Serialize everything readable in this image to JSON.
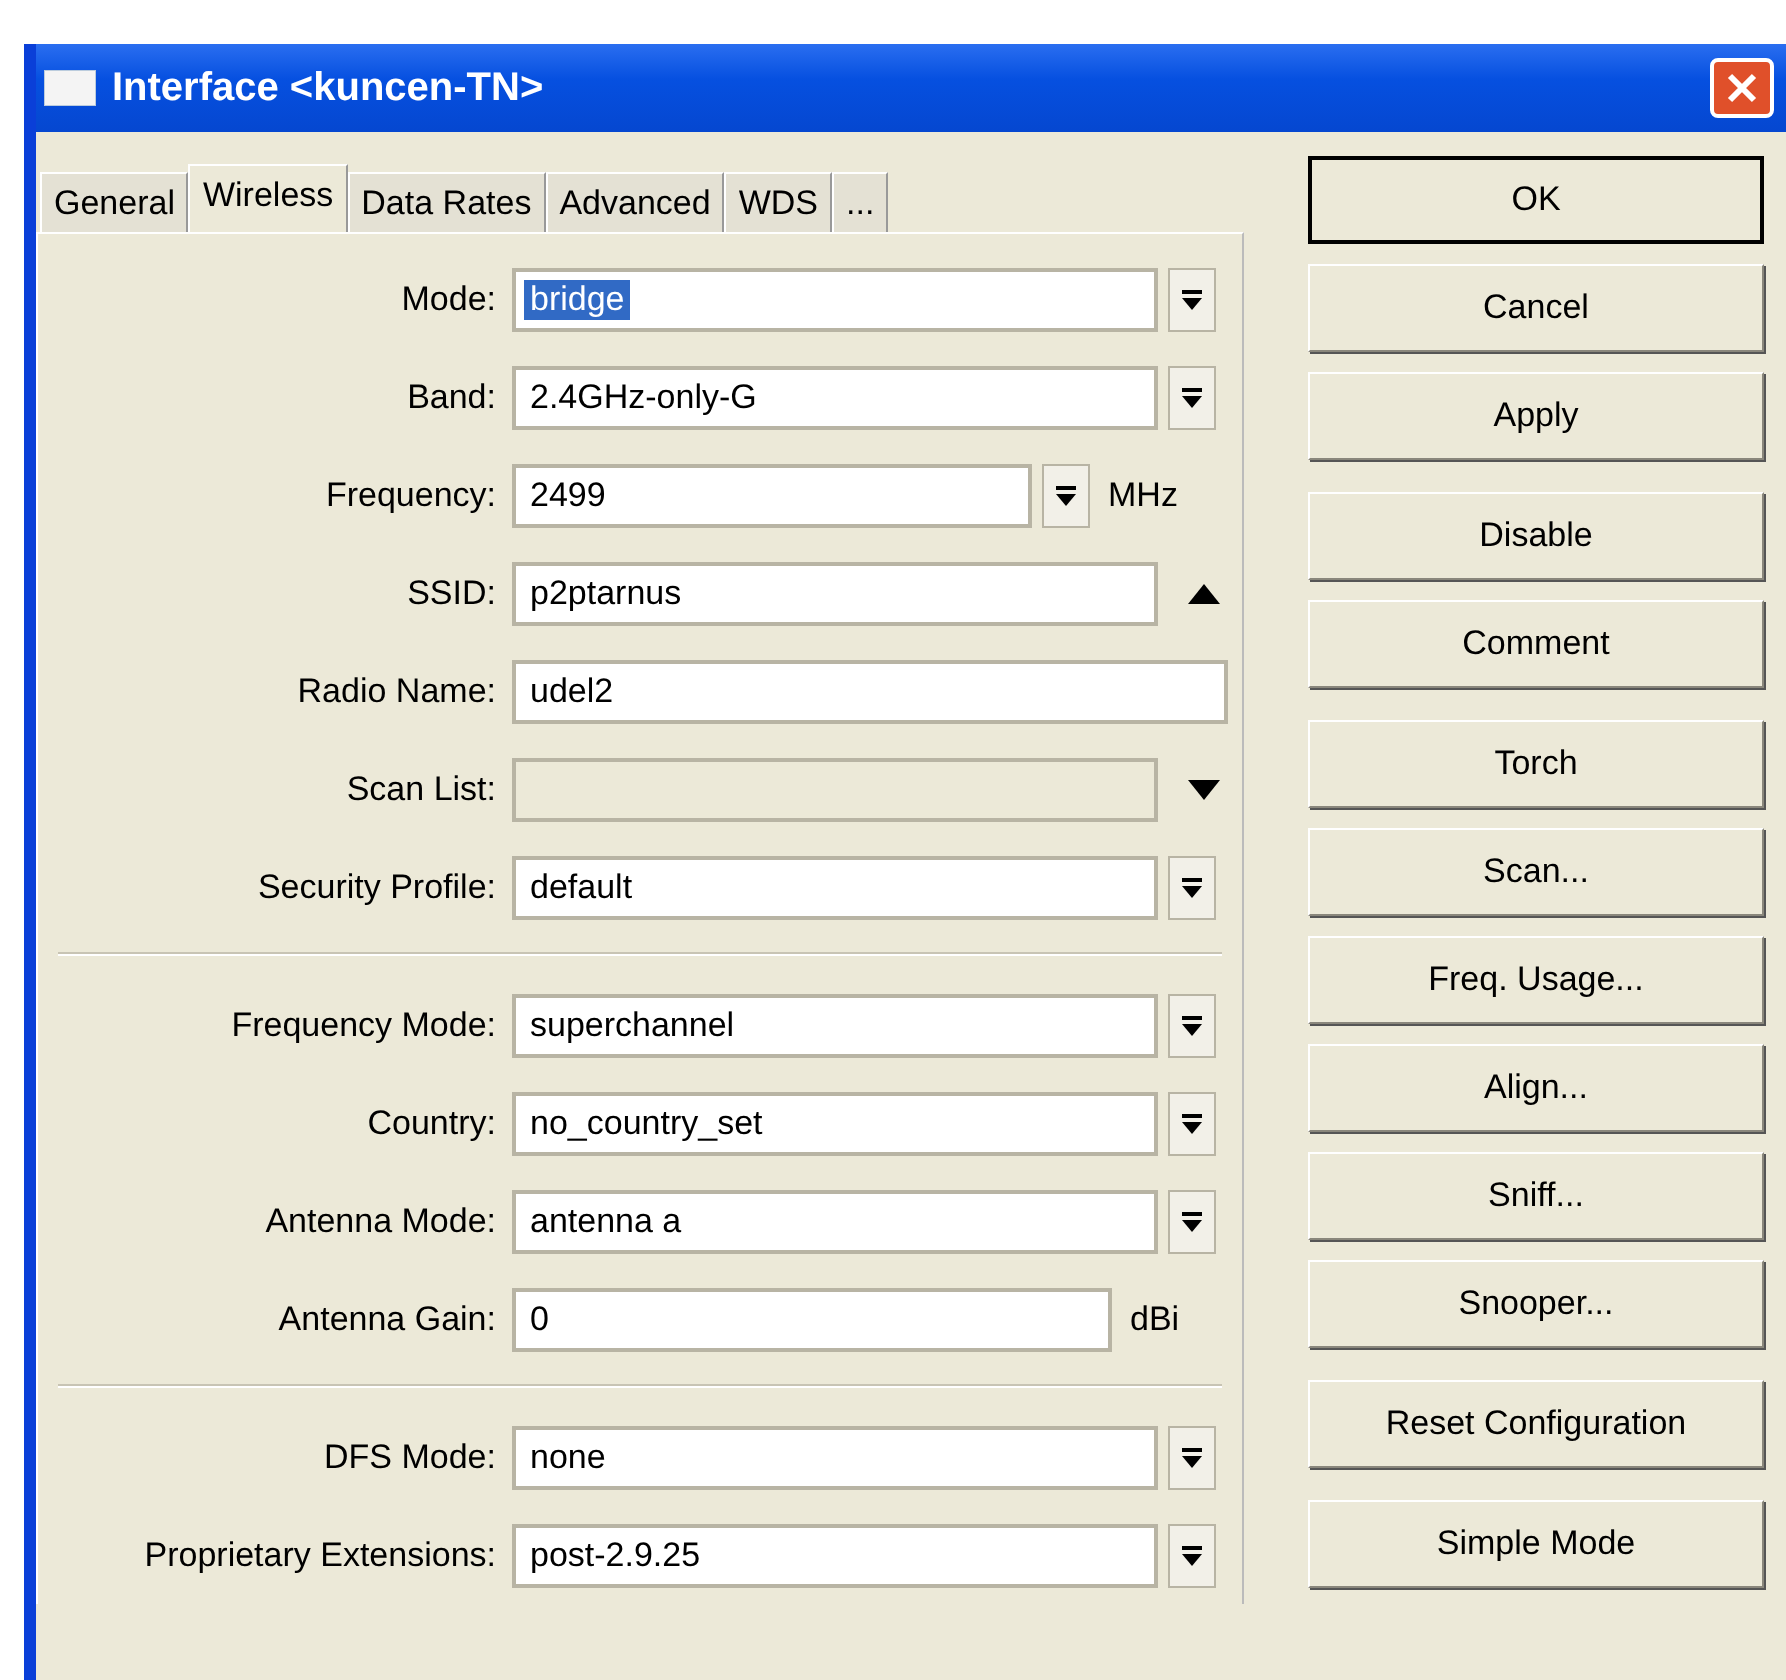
{
  "window": {
    "title": "Interface <kuncen-TN>"
  },
  "tabs": [
    {
      "label": "General",
      "selected": false
    },
    {
      "label": "Wireless",
      "selected": true
    },
    {
      "label": "Data Rates",
      "selected": false
    },
    {
      "label": "Advanced",
      "selected": false
    },
    {
      "label": "WDS",
      "selected": false
    },
    {
      "label": "...",
      "selected": false
    }
  ],
  "sections": [
    {
      "fields": [
        {
          "label": "Mode:",
          "value": "bridge",
          "kind": "dropdown",
          "selected": true
        },
        {
          "label": "Band:",
          "value": "2.4GHz-only-G",
          "kind": "dropdown",
          "selected": false
        },
        {
          "label": "Frequency:",
          "value": "2499",
          "kind": "dropdown_unit",
          "unit": "MHz",
          "selected": false
        },
        {
          "label": "SSID:",
          "value": "p2ptarnus",
          "kind": "collapsible",
          "selected": false
        },
        {
          "label": "Radio Name:",
          "value": "udel2",
          "kind": "text",
          "selected": false
        },
        {
          "label": "Scan List:",
          "kind": "disabled_list"
        },
        {
          "label": "Security Profile:",
          "value": "default",
          "kind": "dropdown",
          "selected": false
        }
      ]
    },
    {
      "fields": [
        {
          "label": "Frequency Mode:",
          "value": "superchannel",
          "kind": "dropdown",
          "selected": false
        },
        {
          "label": "Country:",
          "value": "no_country_set",
          "kind": "dropdown",
          "selected": false
        },
        {
          "label": "Antenna Mode:",
          "value": "antenna a",
          "kind": "dropdown",
          "selected": false
        },
        {
          "label": "Antenna Gain:",
          "value": "0",
          "kind": "text_unit",
          "unit": "dBi",
          "selected": false
        }
      ]
    },
    {
      "fields": [
        {
          "label": "DFS Mode:",
          "value": "none",
          "kind": "dropdown",
          "selected": false
        },
        {
          "label": "Proprietary Extensions:",
          "value": "post-2.9.25",
          "kind": "dropdown",
          "selected": false
        }
      ]
    }
  ],
  "button_groups": [
    {
      "buttons": [
        {
          "label": "OK",
          "default": true
        },
        {
          "label": "Cancel",
          "default": false
        },
        {
          "label": "Apply",
          "default": false
        }
      ]
    },
    {
      "buttons": [
        {
          "label": "Disable",
          "default": false
        },
        {
          "label": "Comment",
          "default": false
        }
      ]
    },
    {
      "buttons": [
        {
          "label": "Torch",
          "default": false
        },
        {
          "label": "Scan...",
          "default": false
        },
        {
          "label": "Freq. Usage...",
          "default": false
        },
        {
          "label": "Align...",
          "default": false
        },
        {
          "label": "Sniff...",
          "default": false
        },
        {
          "label": "Snooper...",
          "default": false
        }
      ]
    },
    {
      "buttons": [
        {
          "label": "Reset Configuration",
          "default": false
        }
      ]
    },
    {
      "buttons": [
        {
          "label": "Simple Mode",
          "default": false
        }
      ]
    }
  ]
}
